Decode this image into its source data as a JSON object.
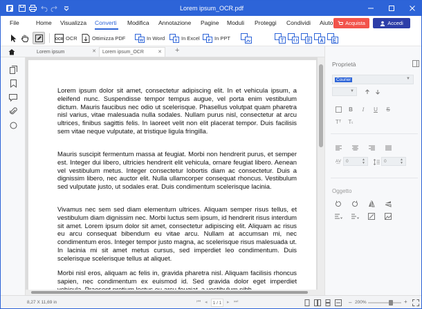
{
  "app": {
    "title": "Lorem ipsum_OCR.pdf"
  },
  "menu": {
    "items": [
      "File",
      "Home",
      "Visualizza",
      "Converti",
      "Modifica",
      "Annotazione",
      "Pagine",
      "Moduli",
      "Proteggi",
      "Condividi",
      "Aiuto"
    ],
    "active": "Converti",
    "buy_label": "Acquista",
    "login_label": "Accedi"
  },
  "ribbon": {
    "ocr_label": "OCR",
    "optimize_label": "Ottimizza PDF",
    "to_word_label": "In Word",
    "to_excel_label": "In Excel",
    "to_ppt_label": "In PPT"
  },
  "tabs": [
    {
      "label": "Lorem ipsum",
      "active": false
    },
    {
      "label": "Lorem ipsum_OCR",
      "active": true
    }
  ],
  "document": {
    "paragraphs": [
      "Lorem ipsum dolor sit amet, consectetur adipiscing elit. In et vehicula ipsum, a eleifend nunc. Suspendisse tempor tempus augue, vel porta enim vestibulum dictum. Mauris faucibus nec odio ut scelerisque. Phasellus volutpat quam pharetra nisl varius, vitae malesuada nulla sodales. Nullam purus nisl, consectetur at arcu ultrices, finibus sagittis felis. In laoreet velit non elit placerat tempor. Duis facilisis sem vitae neque vulputate, at tristique ligula fringilla.",
      "Mauris suscipit fermentum massa at feugiat. Morbi non hendrerit purus, et semper est. Integer dui libero, ultricies hendrerit elit vehicula, ornare feugiat libero. Aenean vel vestibulum metus. Integer consectetur lobortis diam ac consectetur. Duis a dignissim libero, nec auctor elit. Nulla ullamcorper consequat rhoncus. Vestibulum sed vulputate justo, ut sodales erat. Duis condimentum scelerisque lacinia.",
      "Vivamus nec sem sed diam elementum ultrices. Aliquam semper risus tellus, et vestibulum diam dignissim nec. Morbi luctus sem ipsum, id hendrerit risus interdum sit amet. Lorem ipsum dolor sit amet, consectetur adipiscing elit. Aliquam ac risus eu arcu consequat bibendum eu vitae arcu. Nullam at accumsan mi, nec condimentum eros. Integer tempor justo magna, ac scelerisque risus malesuada ut. In lacinia mi sit amet metus cursus, sed imperdiet leo condimentum. Duis scelerisque scelerisque tellus at aliquet.",
      "Morbi nisl eros, aliquam ac felis in, gravida pharetra nisl. Aliquam facilisis rhoncus sapien, nec condimentum ex euismod id. Sed gravida dolor eget imperdiet vehicula. Praesent pretium lectus eu arcu feugiat, a vestibulum nibh"
    ]
  },
  "properties": {
    "title": "Proprietà",
    "font_name": "Courier",
    "size_value": "0",
    "spacing_value": "0",
    "object_section": "Oggetto"
  },
  "status": {
    "page_size": "8,27 X 11,69 in",
    "page_indicator": "1 / 1",
    "zoom": "200%"
  },
  "colors": {
    "accent": "#2d64d8",
    "buy": "#f2534b",
    "login": "#2d3ea8"
  }
}
